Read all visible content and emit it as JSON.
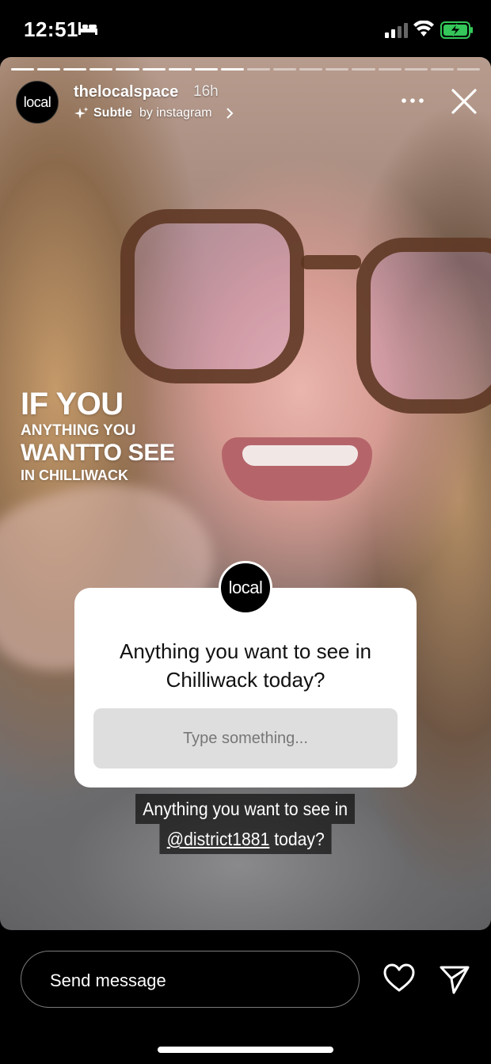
{
  "status_bar": {
    "time": "12:51",
    "icons": [
      "bed-icon",
      "signal-icon",
      "wifi-icon",
      "battery-charging-icon"
    ],
    "battery_color": "#34c759"
  },
  "story": {
    "progress_segments_total": 18,
    "progress_segments_done": 9,
    "account_name": "thelocalspace",
    "post_age": "16h",
    "avatar_logo_text": "local",
    "filter_name": "Subtle",
    "filter_by": "by instagram",
    "overlay_text": {
      "line1": "IF YOU",
      "line2": "ANYTHING YOU",
      "line3": "WANTTO SEE",
      "line4": "IN CHILLIWACK"
    },
    "question_sticker": {
      "question": "Anything you want to see in Chilliwack today?",
      "input_placeholder": "Type something..."
    },
    "caption": {
      "line1": "Anything you want to see in",
      "mention": "@district1881",
      "line2_suffix": " today?"
    }
  },
  "bottom_bar": {
    "message_placeholder": "Send message",
    "icons": [
      "heart-icon",
      "send-icon"
    ]
  }
}
